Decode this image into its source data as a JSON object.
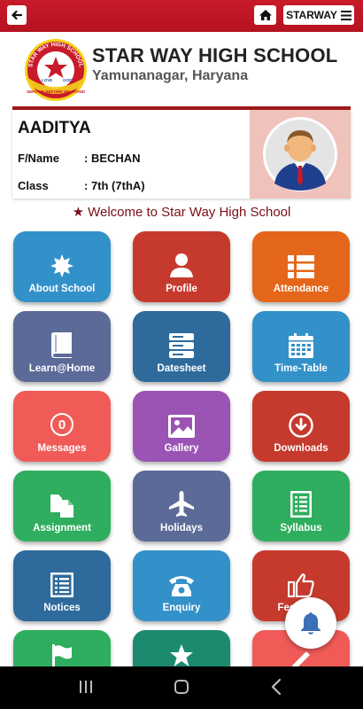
{
  "topbar": {
    "back_icon": "back-arrow-icon",
    "home_icon": "home-icon",
    "menu_label": "STARWAY",
    "menu_icon": "hamburger-icon",
    "color": "#c81b2a"
  },
  "header": {
    "school_name": "STAR WAY HIGH SCHOOL",
    "location": "Yamunanagar, Haryana",
    "logo": {
      "top_text": "STAR WAY HIGH SCHOOL",
      "left_text": "LOVE",
      "right_text": "GOD",
      "bottom_text": "SERVICE BEFORE WE STAND"
    }
  },
  "student": {
    "name": "AADITYA",
    "father_label": "F/Name",
    "father_value": ": BECHAN",
    "class_label": "Class",
    "class_value": ": 7th (7thA)",
    "avatar_icon": "student-avatar-icon"
  },
  "welcome": {
    "star": "★",
    "text": "Welcome to Star Way High School"
  },
  "tiles": [
    {
      "label": "About School",
      "icon": "starburst-icon",
      "color": "#3391c9"
    },
    {
      "label": "Profile",
      "icon": "person-icon",
      "color": "#c63a2e"
    },
    {
      "label": "Attendance",
      "icon": "list-icon",
      "color": "#e4661a"
    },
    {
      "label": "Learn@Home",
      "icon": "book-icon",
      "color": "#5b6a97"
    },
    {
      "label": "Datesheet",
      "icon": "server-icon",
      "color": "#2e6b9c"
    },
    {
      "label": "Time-Table",
      "icon": "calendar-icon",
      "color": "#3391c9"
    },
    {
      "label": "Messages",
      "icon": "counter-badge-icon",
      "badge": "0",
      "color": "#f05b57"
    },
    {
      "label": "Gallery",
      "icon": "image-icon",
      "color": "#9b53b4"
    },
    {
      "label": "Downloads",
      "icon": "download-circle-icon",
      "color": "#c63a2e"
    },
    {
      "label": "Assignment",
      "icon": "copy-icon",
      "color": "#2eae5e"
    },
    {
      "label": "Holidays",
      "icon": "airplane-icon",
      "color": "#5b6a97"
    },
    {
      "label": "Syllabus",
      "icon": "document-list-icon",
      "color": "#2eae5e"
    },
    {
      "label": "Notices",
      "icon": "notice-board-icon",
      "color": "#2e6b9c"
    },
    {
      "label": "Enquiry",
      "icon": "telephone-icon",
      "color": "#3391c9"
    },
    {
      "label": "Feedback",
      "icon": "thumbs-up-icon",
      "color": "#c63a2e"
    },
    {
      "label": "",
      "icon": "flag-icon",
      "color": "#2eae5e"
    },
    {
      "label": "",
      "icon": "star-icon",
      "color": "#1b8a6e"
    },
    {
      "label": "",
      "icon": "pencil-icon",
      "color": "#f05b57"
    }
  ],
  "fab": {
    "icon": "bell-icon",
    "color": "#3b6fb6"
  },
  "navbar": {
    "recents_icon": "recents-icon",
    "home_icon": "nav-home-icon",
    "back_icon": "nav-back-icon"
  }
}
